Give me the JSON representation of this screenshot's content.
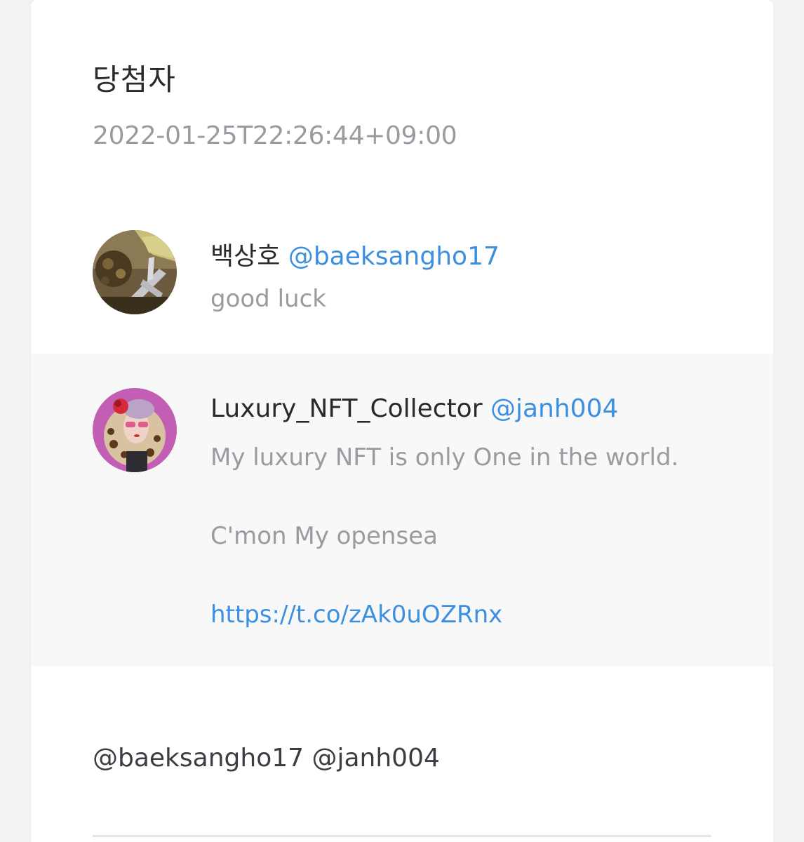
{
  "header": {
    "title": "당첨자",
    "timestamp": "2022-01-25T22:26:44+09:00"
  },
  "winners": [
    {
      "name": "백상호",
      "handle": "@baeksangho17",
      "comment_lines": [
        "good luck"
      ],
      "avatar_icon": "avatar-photo"
    },
    {
      "name": "Luxury_NFT_Collector",
      "handle": "@janh004",
      "comment_lines": [
        "My luxury NFT is only One in the world.",
        "",
        "C'mon My opensea",
        ""
      ],
      "link": "https://t.co/zAk0uOZRnx",
      "avatar_icon": "avatar-illustration"
    }
  ],
  "mentions": "@baeksangho17 @janh004",
  "colors": {
    "link": "#3d8fe0",
    "secondary_text": "#9a9ba0",
    "primary_text": "#2a2a2e",
    "highlight_row": "#f8f8f9"
  }
}
